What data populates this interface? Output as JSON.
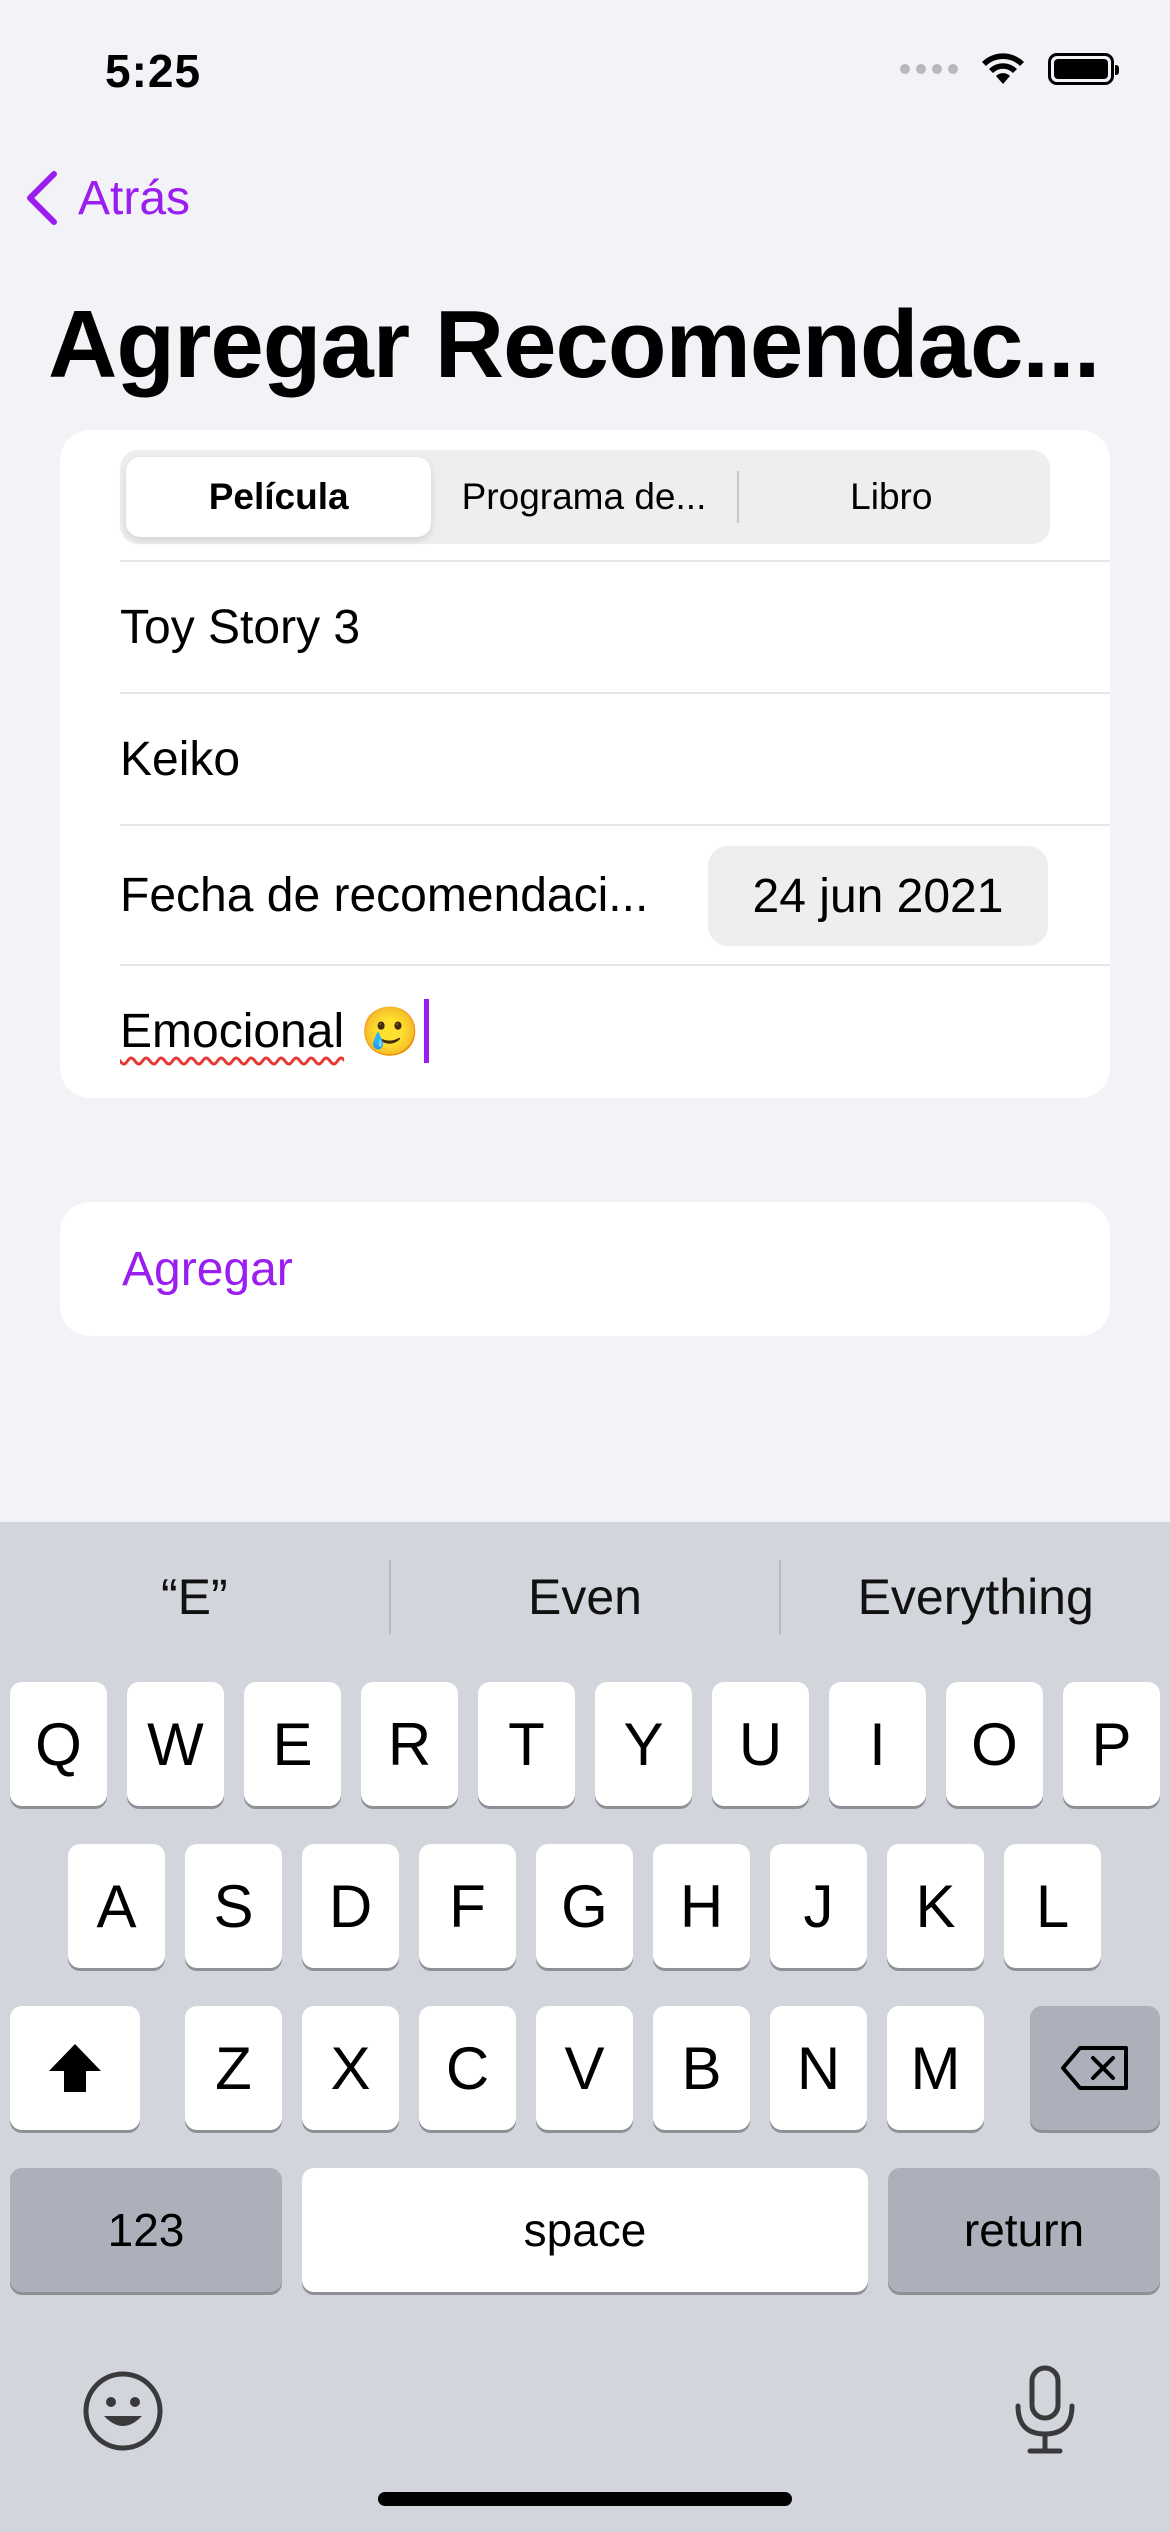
{
  "status": {
    "time": "5:25"
  },
  "nav": {
    "back_label": "Atrás",
    "title": "Agregar Recomendac..."
  },
  "form": {
    "segments": [
      {
        "label": "Película",
        "selected": true
      },
      {
        "label": "Programa de..."
      },
      {
        "label": "Libro"
      }
    ],
    "title_value": "Toy Story 3",
    "recommender_value": "Keiko",
    "date_label": "Fecha de recomendaci...",
    "date_value": "24 jun 2021",
    "note_word": "Emocional",
    "note_emoji": "🥲"
  },
  "add_button": {
    "label": "Agregar"
  },
  "keyboard": {
    "suggestions": [
      "“E”",
      "Even",
      "Everything"
    ],
    "row1": [
      "Q",
      "W",
      "E",
      "R",
      "T",
      "Y",
      "U",
      "I",
      "O",
      "P"
    ],
    "row2": [
      "A",
      "S",
      "D",
      "F",
      "G",
      "H",
      "J",
      "K",
      "L"
    ],
    "row3": [
      "Z",
      "X",
      "C",
      "V",
      "B",
      "N",
      "M"
    ],
    "numbers_label": "123",
    "space_label": "space",
    "return_label": "return"
  },
  "colors": {
    "accent": "#9a1ef0",
    "background": "#f2f2f7",
    "keyboard": "#d3d5dc"
  }
}
